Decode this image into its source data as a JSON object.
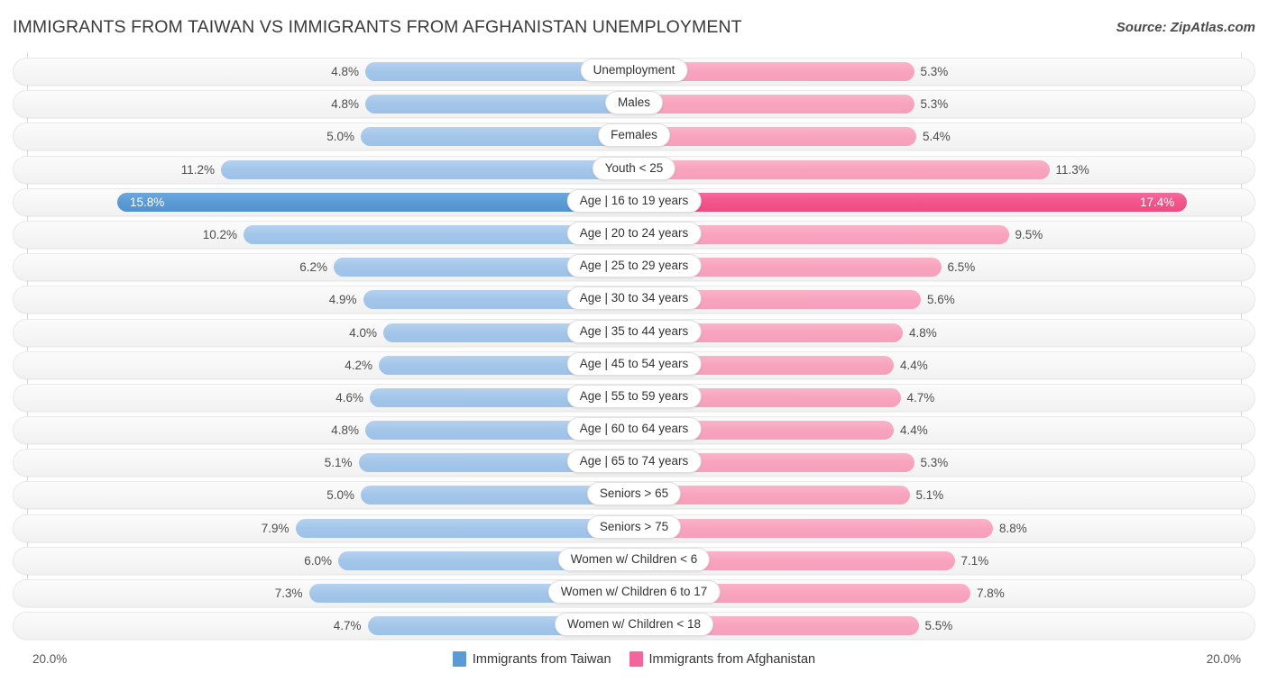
{
  "header": {
    "title": "IMMIGRANTS FROM TAIWAN VS IMMIGRANTS FROM AFGHANISTAN UNEMPLOYMENT",
    "source": "Source: ZipAtlas.com"
  },
  "axis": {
    "left_label": "20.0%",
    "right_label": "20.0%"
  },
  "legend": {
    "items": [
      {
        "label": "Immigrants from Taiwan",
        "color": "#5b9bd5"
      },
      {
        "label": "Immigrants from Afghanistan",
        "color": "#f2669b"
      }
    ]
  },
  "colors": {
    "left_normal": "#a3c6e9",
    "left_max": "#5b9bd5",
    "right_normal": "#f8a4bf",
    "right_max": "#f2558a",
    "track": "#f6f6f6",
    "gridline": "#d8d8d8"
  },
  "chart_data": {
    "type": "bar",
    "title": "IMMIGRANTS FROM TAIWAN VS IMMIGRANTS FROM AFGHANISTAN UNEMPLOYMENT",
    "subtitle": "Source: ZipAtlas.com",
    "orientation": "horizontal-diverging",
    "xlabel": "",
    "ylabel": "",
    "xlim": [
      20.0,
      20.0
    ],
    "grid": true,
    "legend_position": "bottom-center",
    "unit": "%",
    "categories": [
      "Unemployment",
      "Males",
      "Females",
      "Youth < 25",
      "Age | 16 to 19 years",
      "Age | 20 to 24 years",
      "Age | 25 to 29 years",
      "Age | 30 to 34 years",
      "Age | 35 to 44 years",
      "Age | 45 to 54 years",
      "Age | 55 to 59 years",
      "Age | 60 to 64 years",
      "Age | 65 to 74 years",
      "Seniors > 65",
      "Seniors > 75",
      "Women w/ Children < 6",
      "Women w/ Children 6 to 17",
      "Women w/ Children < 18"
    ],
    "series": [
      {
        "name": "Immigrants from Taiwan",
        "color": "#5b9bd5",
        "values": [
          4.8,
          4.8,
          5.0,
          11.2,
          15.8,
          10.2,
          6.2,
          4.9,
          4.0,
          4.2,
          4.6,
          4.8,
          5.1,
          5.0,
          7.9,
          6.0,
          7.3,
          4.7
        ],
        "labels": [
          "4.8%",
          "4.8%",
          "5.0%",
          "11.2%",
          "15.8%",
          "10.2%",
          "6.2%",
          "4.9%",
          "4.0%",
          "4.2%",
          "4.6%",
          "4.8%",
          "5.1%",
          "5.0%",
          "7.9%",
          "6.0%",
          "7.3%",
          "4.7%"
        ]
      },
      {
        "name": "Immigrants from Afghanistan",
        "color": "#f2558a",
        "values": [
          5.3,
          5.3,
          5.4,
          11.3,
          17.4,
          9.5,
          6.5,
          5.6,
          4.8,
          4.4,
          4.7,
          4.4,
          5.3,
          5.1,
          8.8,
          7.1,
          7.8,
          5.5
        ],
        "labels": [
          "5.3%",
          "5.3%",
          "5.4%",
          "11.3%",
          "17.4%",
          "9.5%",
          "6.5%",
          "5.6%",
          "4.8%",
          "4.4%",
          "4.7%",
          "4.4%",
          "5.3%",
          "5.1%",
          "8.8%",
          "7.1%",
          "7.8%",
          "5.5%"
        ]
      }
    ],
    "highlight_row_index": 4
  }
}
